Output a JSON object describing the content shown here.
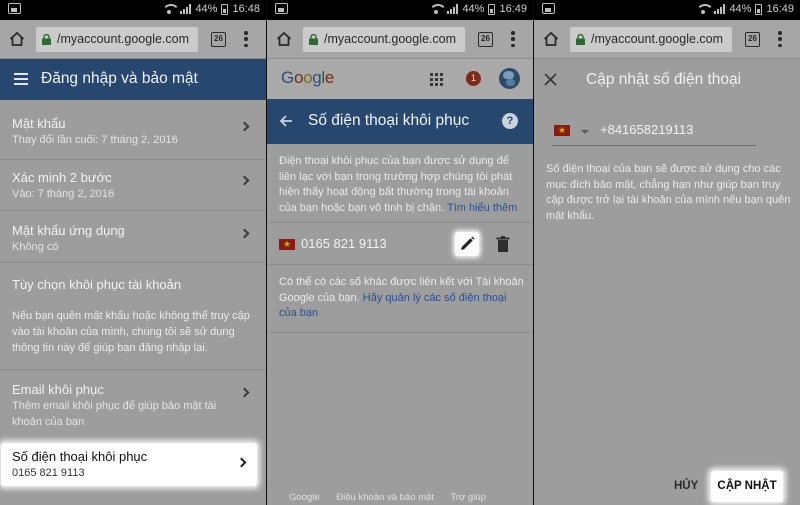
{
  "status_bar": {
    "battery": "44%",
    "times": [
      "16:48",
      "16:49",
      "16:49"
    ]
  },
  "browser": {
    "url": "/myaccount.google.com",
    "tab_count": "26"
  },
  "screen1": {
    "title": "Đăng nhập và bảo mật",
    "items": [
      {
        "title": "Mật khẩu",
        "subtitle": "Thay đổi lần cuối: 7 tháng 2, 2016"
      },
      {
        "title": "Xác minh 2 bước",
        "subtitle": "Vào: 7 tháng 2, 2016"
      },
      {
        "title": "Mật khẩu ứng dụng",
        "subtitle": "Không có"
      }
    ],
    "section_title": "Tùy chọn khôi phục tài khoản",
    "section_text": "Nếu bạn quên mật khẩu hoặc không thể truy cập vào tài khoản của mình, chúng tôi sẽ sử dụng thông tin này để giúp bạn đăng nhập lại.",
    "email_item": {
      "title": "Email khôi phục",
      "subtitle": "Thêm email khôi phục để giúp bảo mật tài khoản của bạn"
    },
    "phone_item": {
      "title": "Số điện thoại khôi phục",
      "subtitle": "0165 821 9113"
    }
  },
  "screen2": {
    "logo": {
      "letters": [
        "G",
        "o",
        "o",
        "g",
        "l",
        "e"
      ],
      "colors": [
        "#2f4f7f",
        "#7a2a1e",
        "#7d6a1a",
        "#2f4f7f",
        "#2f5a33",
        "#7a2a1e"
      ]
    },
    "notification_count": "1",
    "title": "Số điện thoại khôi phục",
    "intro": "Điện thoại khôi phục của bạn được sử dụng để liên lạc với bạn trong trường hợp chúng tôi phát hiện thấy hoạt động bất thường trong tài khoản của bạn hoặc bạn vô tình bị chặn.",
    "learn_more": "Tìm hiểu thêm",
    "phone": "0165 821 9113",
    "other_text": "Có thể có các số khác được liên kết với Tài khoản Google của bạn.",
    "manage_link": "Hãy quản lý các số điện thoại của bạn",
    "footer": [
      "Google",
      "Điều khoản và bảo mật",
      "Trợ giúp"
    ]
  },
  "screen3": {
    "title": "Cập nhật số điện thoại",
    "phone_value": "+841658219113",
    "description": "Số điện thoại của bạn sẽ được sử dụng cho các mục đích bảo mật, chẳng hạn như giúp bạn truy cập được trở lại tài khoản của mình nếu bạn quên mật khẩu.",
    "cancel_label": "HỦY",
    "update_label": "CẬP NHẬT"
  }
}
